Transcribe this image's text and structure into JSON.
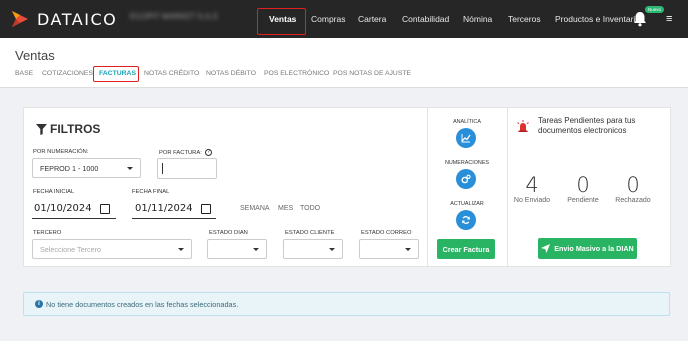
{
  "app": {
    "brand": "DATAICO",
    "company": "ECOPIT MARKET S.A.S"
  },
  "nav": {
    "items": [
      "Ventas",
      "Compras",
      "Cartera",
      "Contabilidad",
      "Nómina",
      "Terceros",
      "Productos e Inventario"
    ],
    "badge": "Nuevo"
  },
  "page": {
    "title": "Ventas"
  },
  "tabs": [
    "BASE",
    "COTIZACIONES",
    "FACTURAS",
    "NOTAS CRÉDITO",
    "NOTAS DÉBITO",
    "POS ELECTRÓNICO",
    "POS NOTAS DE AJUSTE"
  ],
  "filters": {
    "title": "FILTROS",
    "numeracion_label": "POR NUMERACIÓN:",
    "numeracion_value": "FEPROD 1 - 1000",
    "factura_label": "POR FACTURA:",
    "fecha_inicial_label": "FECHA INICIAL",
    "fecha_inicial_value": "01/10/2024",
    "fecha_final_label": "FECHA FINAL",
    "fecha_final_value": "01/11/2024",
    "range": [
      "SEMANA",
      "MES",
      "TODO"
    ],
    "tercero_label": "TERCERO",
    "tercero_placeholder": "Seleccione Tercero",
    "estado_dian_label": "ESTADO DIAN",
    "estado_cliente_label": "ESTADO CLIENTE",
    "estado_correo_label": "ESTADO CORREO"
  },
  "side": {
    "analitica": "ANALÍTICA",
    "numeraciones": "NUMERACIONES",
    "actualizar": "ACTUALIZAR",
    "crear_factura": "Crear Factura"
  },
  "tasks": {
    "title": "Tareas Pendientes para tus documentos electronicos",
    "stats": [
      {
        "value": "4",
        "label": "No Enviado"
      },
      {
        "value": "0",
        "label": "Pendiente"
      },
      {
        "value": "0",
        "label": "Rechazado"
      }
    ],
    "envio_button": "Envio Masivo a la DIAN"
  },
  "alert": {
    "text": "No tiene documentos creados en las fechas seleccionadas."
  },
  "colors": {
    "accent": "#17a2b8",
    "primary": "#2a8fd9",
    "success": "#28b463",
    "highlight": "#e02020",
    "topbar": "#262626"
  }
}
